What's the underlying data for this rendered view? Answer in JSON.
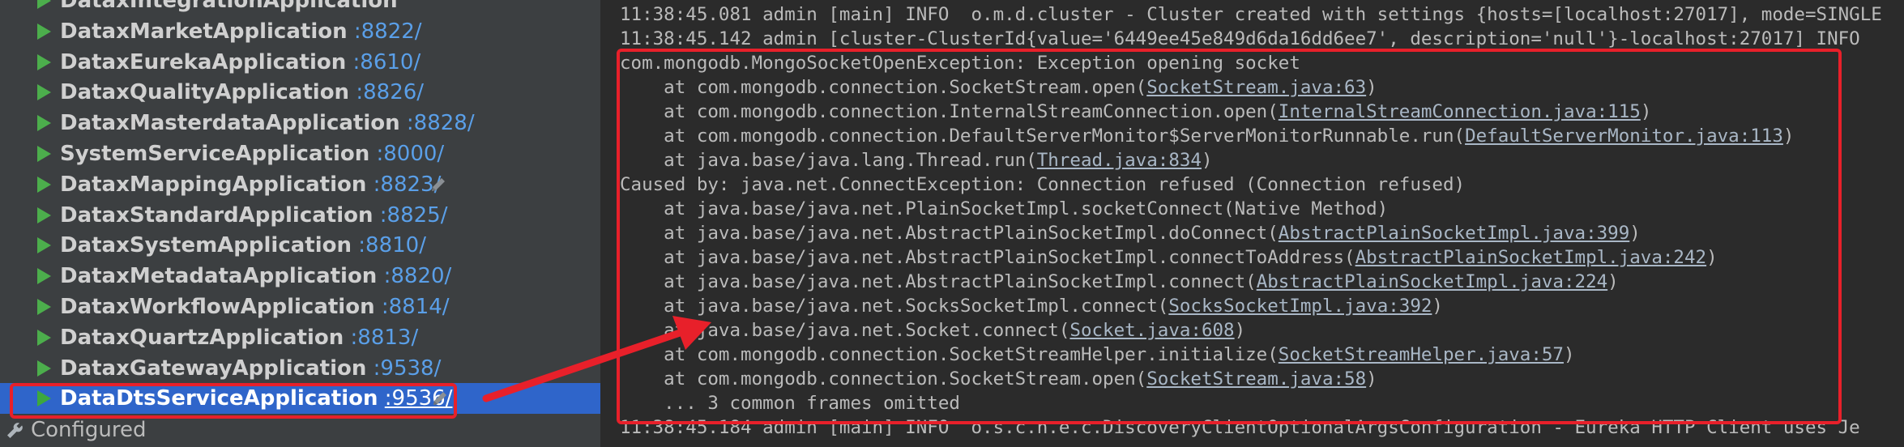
{
  "sidebar": {
    "services": [
      {
        "name": "DataxIntegrationApplication",
        "port": "",
        "selected": false,
        "edit": false
      },
      {
        "name": "DataxMarketApplication",
        "port": ":8822/",
        "selected": false,
        "edit": false
      },
      {
        "name": "DataxEurekaApplication",
        "port": ":8610/",
        "selected": false,
        "edit": false
      },
      {
        "name": "DataxQualityApplication",
        "port": ":8826/",
        "selected": false,
        "edit": false
      },
      {
        "name": "DataxMasterdataApplication",
        "port": ":8828/",
        "selected": false,
        "edit": false
      },
      {
        "name": "SystemServiceApplication",
        "port": ":8000/",
        "selected": false,
        "edit": false
      },
      {
        "name": "DataxMappingApplication",
        "port": ":8823/",
        "selected": false,
        "edit": true
      },
      {
        "name": "DataxStandardApplication",
        "port": ":8825/",
        "selected": false,
        "edit": false
      },
      {
        "name": "DataxSystemApplication",
        "port": ":8810/",
        "selected": false,
        "edit": false
      },
      {
        "name": "DataxMetadataApplication",
        "port": ":8820/",
        "selected": false,
        "edit": false
      },
      {
        "name": "DataxWorkflowApplication",
        "port": ":8814/",
        "selected": false,
        "edit": false
      },
      {
        "name": "DataxQuartzApplication",
        "port": ":8813/",
        "selected": false,
        "edit": false
      },
      {
        "name": "DataxGatewayApplication",
        "port": ":9538/",
        "selected": false,
        "edit": false
      },
      {
        "name": "DataDtsServiceApplication",
        "port": ":9536/",
        "selected": true,
        "edit": true
      }
    ],
    "configured_label": "Configured"
  },
  "console": {
    "lines": [
      {
        "pre": "11:38:45.081 admin [main] INFO  o.m.d.cluster - Cluster created with settings {hosts=[localhost:27017], mode=SINGLE",
        "link": "",
        "post": ""
      },
      {
        "pre": "11:38:45.142 admin [cluster-ClusterId{value='6449ee45e849d6da16dd6ee7', description='null'}-localhost:27017] INFO",
        "link": "",
        "post": ""
      },
      {
        "pre": "com.mongodb.MongoSocketOpenException: Exception opening socket",
        "link": "",
        "post": ""
      },
      {
        "pre": "    at com.mongodb.connection.SocketStream.open(",
        "link": "SocketStream.java:63",
        "post": ")"
      },
      {
        "pre": "    at com.mongodb.connection.InternalStreamConnection.open(",
        "link": "InternalStreamConnection.java:115",
        "post": ")"
      },
      {
        "pre": "    at com.mongodb.connection.DefaultServerMonitor$ServerMonitorRunnable.run(",
        "link": "DefaultServerMonitor.java:113",
        "post": ")"
      },
      {
        "pre": "    at java.base/java.lang.Thread.run(",
        "link": "Thread.java:834",
        "post": ")"
      },
      {
        "pre": "Caused by: java.net.ConnectException: Connection refused (Connection refused)",
        "link": "",
        "post": ""
      },
      {
        "pre": "    at java.base/java.net.PlainSocketImpl.socketConnect(Native Method)",
        "link": "",
        "post": ""
      },
      {
        "pre": "    at java.base/java.net.AbstractPlainSocketImpl.doConnect(",
        "link": "AbstractPlainSocketImpl.java:399",
        "post": ")"
      },
      {
        "pre": "    at java.base/java.net.AbstractPlainSocketImpl.connectToAddress(",
        "link": "AbstractPlainSocketImpl.java:242",
        "post": ")"
      },
      {
        "pre": "    at java.base/java.net.AbstractPlainSocketImpl.connect(",
        "link": "AbstractPlainSocketImpl.java:224",
        "post": ")"
      },
      {
        "pre": "    at java.base/java.net.SocksSocketImpl.connect(",
        "link": "SocksSocketImpl.java:392",
        "post": ")"
      },
      {
        "pre": "    at java.base/java.net.Socket.connect(",
        "link": "Socket.java:608",
        "post": ")"
      },
      {
        "pre": "    at com.mongodb.connection.SocketStreamHelper.initialize(",
        "link": "SocketStreamHelper.java:57",
        "post": ")"
      },
      {
        "pre": "    at com.mongodb.connection.SocketStream.open(",
        "link": "SocketStream.java:58",
        "post": ")"
      },
      {
        "pre": "    ... 3 common frames omitted",
        "link": "",
        "post": ""
      },
      {
        "pre": "11:38:45.184 admin [main] INFO  o.s.c.n.e.c.DiscoveryClientOptionalArgsConfiguration - Eureka HTTP Client uses Je",
        "link": "",
        "post": ""
      }
    ]
  },
  "colors": {
    "highlight": "#e8202a",
    "selected_row": "#2f65ca",
    "run_icon": "#4cae4c",
    "port_link": "#5a9fe8"
  },
  "icons": {
    "run": "play-icon",
    "edit": "pencil-icon",
    "configured": "wrench-icon"
  }
}
